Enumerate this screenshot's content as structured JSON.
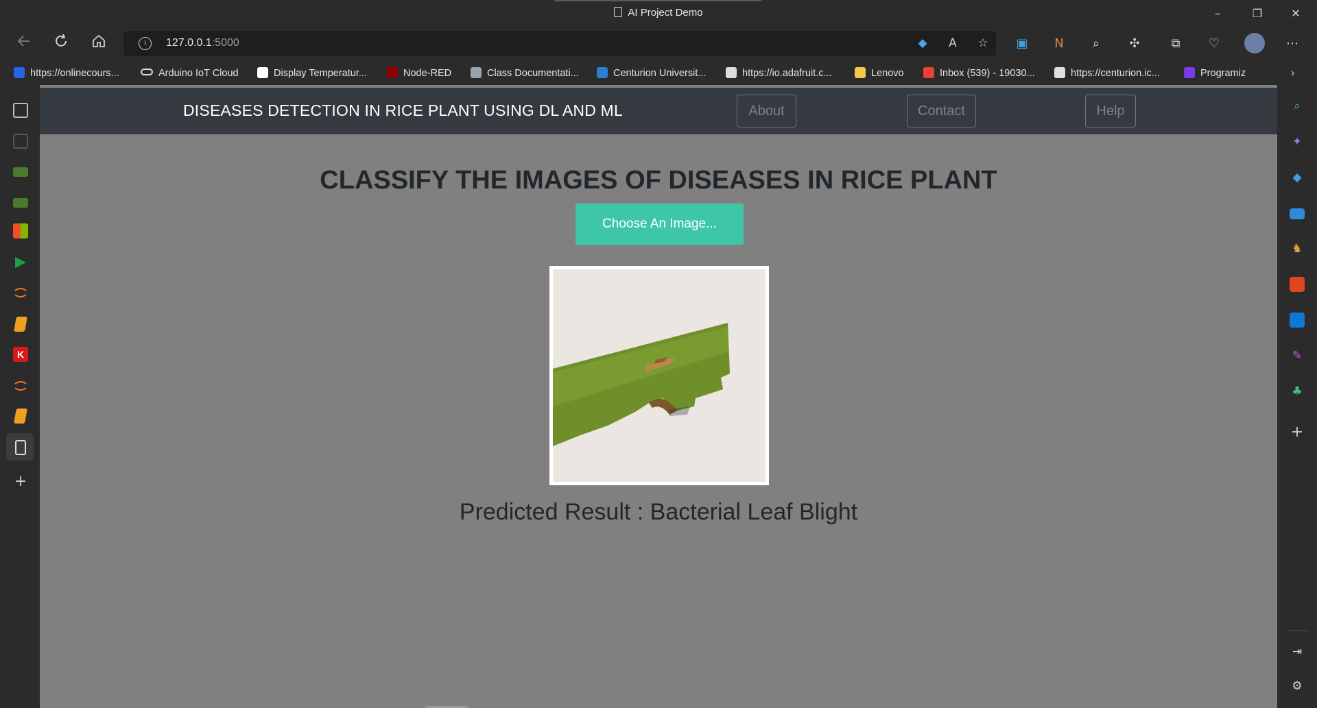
{
  "window": {
    "title": "AI Project Demo",
    "controls": [
      "–",
      "❐",
      "✕"
    ]
  },
  "address_bar": {
    "url_host": "127.0.0.1",
    "url_port": ":5000"
  },
  "bookmarks": [
    {
      "label": "https://onlinecours...",
      "color": "#2563eb"
    },
    {
      "label": "Arduino IoT Cloud",
      "color": "#2b2b2b"
    },
    {
      "label": "Display Temperatur...",
      "color": "#ffffff"
    },
    {
      "label": "Node-RED",
      "color": "#8f0000"
    },
    {
      "label": "Class Documentati...",
      "color": "#9aa3ad"
    },
    {
      "label": "Centurion Universit...",
      "color": "#2a7fd4"
    },
    {
      "label": "https://io.adafruit.c...",
      "color": "#dddddd"
    },
    {
      "label": "Lenovo",
      "color": "#f2c94c"
    },
    {
      "label": "Inbox (539) - 19030...",
      "color": "#ea4335"
    },
    {
      "label": "https://centurion.ic...",
      "color": "#e0e0e0"
    },
    {
      "label": "Programiz",
      "color": "#7c3aed"
    }
  ],
  "page": {
    "brand": "DISEASES DETECTION IN RICE PLANT USING DL AND ML",
    "nav": {
      "about": "About",
      "contact": "Contact",
      "help": "Help"
    },
    "heading": "CLASSIFY THE IMAGES OF DISEASES IN RICE PLANT",
    "choose_button": "Choose An Image...",
    "result": "Predicted Result : Bacterial Leaf Blight"
  },
  "colors": {
    "navbar": "#343a40",
    "page_bg": "#808080",
    "accent_button": "#3ec6a8"
  }
}
